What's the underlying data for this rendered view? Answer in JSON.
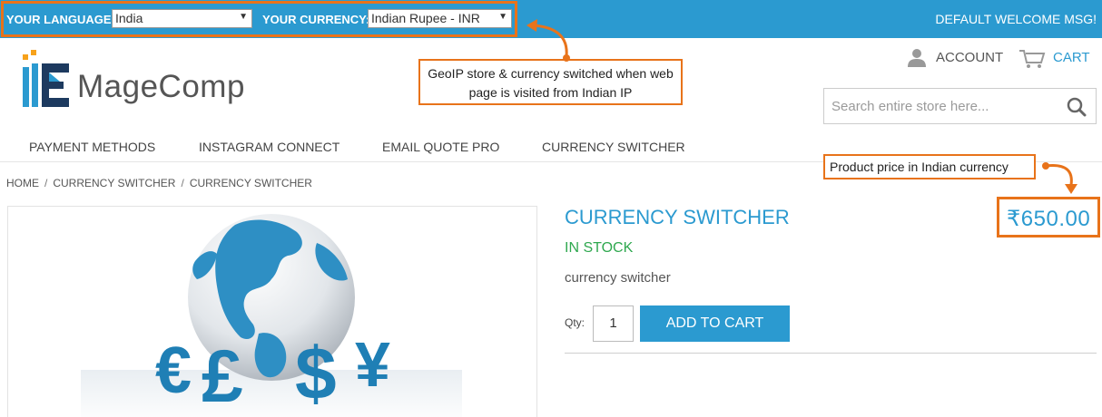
{
  "topbar": {
    "language_label": "YOUR LANGUAGE:",
    "language_value": "India",
    "currency_label": "YOUR CURRENCY:",
    "currency_value": "Indian Rupee - INR",
    "welcome": "DEFAULT WELCOME MSG!"
  },
  "header": {
    "logo_text": "MageComp",
    "account_label": "ACCOUNT",
    "cart_label": "CART",
    "search_placeholder": "Search entire store here..."
  },
  "nav": {
    "items": [
      "PAYMENT METHODS",
      "INSTAGRAM CONNECT",
      "EMAIL QUOTE PRO",
      "CURRENCY SWITCHER"
    ]
  },
  "breadcrumb": [
    "HOME",
    "CURRENCY SWITCHER",
    "CURRENCY SWITCHER"
  ],
  "breadcrumb_separator": "/",
  "product": {
    "title": "CURRENCY SWITCHER",
    "stock": "IN STOCK",
    "description": "currency switcher",
    "qty_label": "Qty:",
    "qty_value": "1",
    "add_to_cart": "ADD TO CART",
    "price": "₹650.00",
    "image_currency_symbols": [
      "€",
      "£",
      "$",
      "¥"
    ]
  },
  "annotations": {
    "geoip": "GeoIP store & currency switched when web page is visited from Indian IP",
    "price": "Product price in Indian currency"
  },
  "colors": {
    "accent": "#2b9ad0",
    "stock_green": "#2fa84f",
    "highlight_orange": "#e8731a"
  }
}
